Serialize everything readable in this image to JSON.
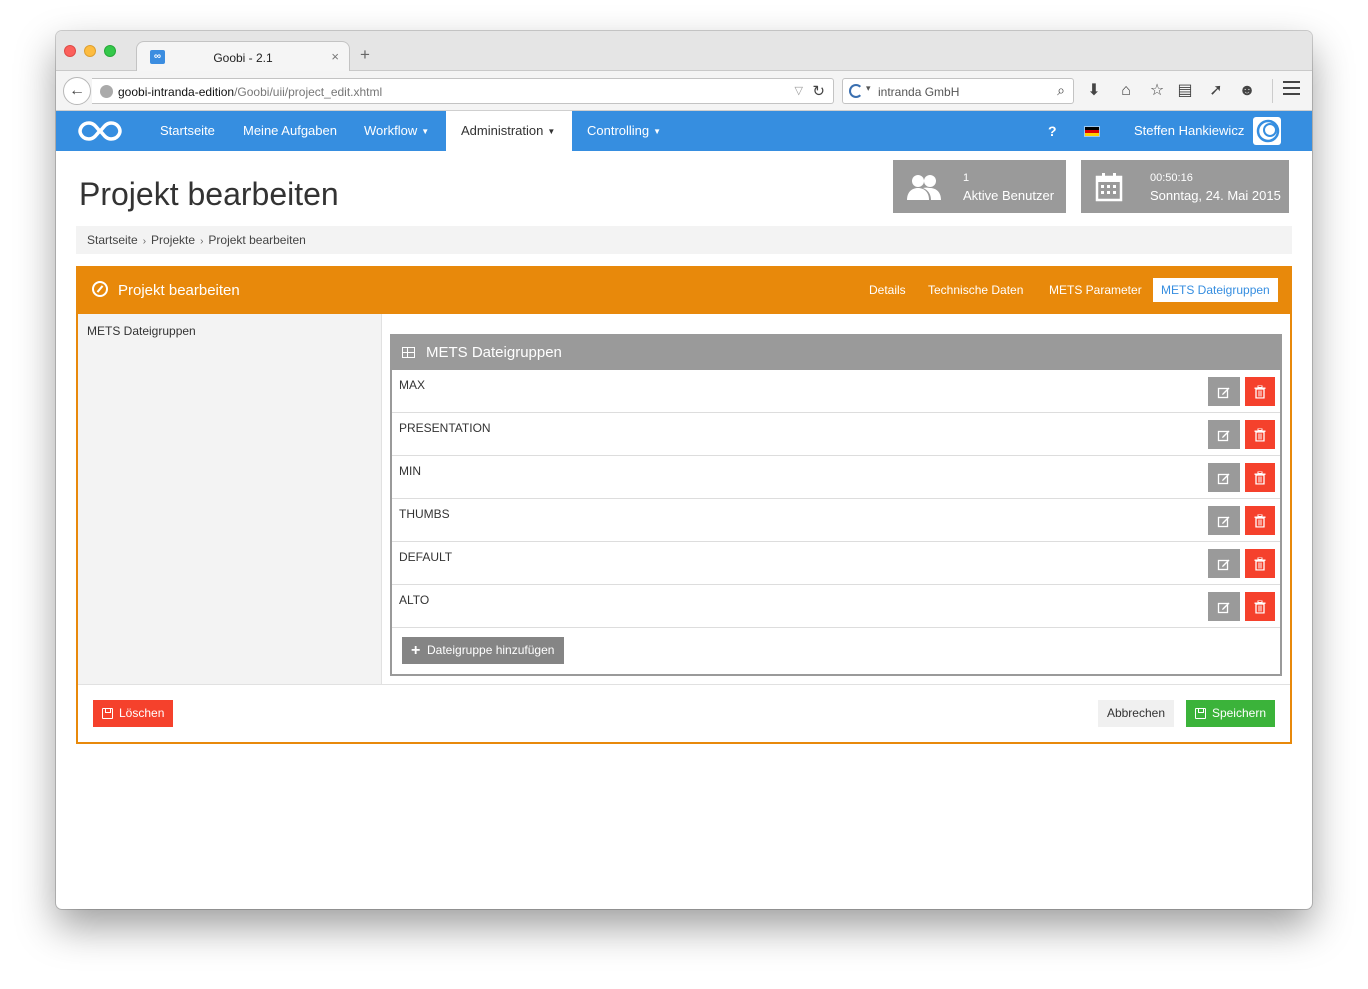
{
  "browser": {
    "tab_title": "Goobi - 2.1",
    "tab_favicon": "∞",
    "url_host": "goobi-intranda-edition",
    "url_path": "/Goobi/uii/project_edit.xhtml",
    "search_engine": "intranda GmbH"
  },
  "nav": {
    "items": [
      {
        "label": "Startseite"
      },
      {
        "label": "Meine Aufgaben"
      },
      {
        "label": "Workflow"
      },
      {
        "label": "Administration"
      },
      {
        "label": "Controlling"
      }
    ],
    "help": "?",
    "user": "Steffen Hankiewicz",
    "flag_colors": [
      "#000000",
      "#dd0000",
      "#ffce00"
    ]
  },
  "page": {
    "title": "Projekt bearbeiten",
    "users_count": "1",
    "users_label": "Aktive Benutzer",
    "time": "00:50:16",
    "date": "Sonntag, 24. Mai 2015"
  },
  "breadcrumb": [
    "Startseite",
    "Projekte",
    "Projekt bearbeiten"
  ],
  "panel": {
    "title": "Projekt bearbeiten",
    "tabs": [
      "Details",
      "Technische Daten",
      "METS Parameter",
      "METS Dateigruppen"
    ],
    "active_tab": "METS Dateigruppen",
    "side_label": "METS Dateigruppen",
    "box_title": "METS Dateigruppen",
    "rows": [
      "MAX",
      "PRESENTATION",
      "MIN",
      "THUMBS",
      "DEFAULT",
      "ALTO"
    ],
    "add_label": "Dateigruppe hinzufügen",
    "delete_label": "Löschen",
    "cancel_label": "Abbrechen",
    "save_label": "Speichern"
  },
  "colors": {
    "primary": "#368ee0",
    "accent": "#e8890b",
    "danger": "#f5412c",
    "success": "#3bb33a",
    "neutral": "#9a9a9a"
  }
}
